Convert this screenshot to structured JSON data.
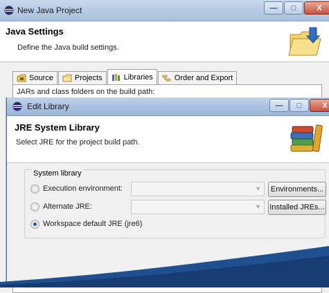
{
  "outer_window": {
    "title": "New Java Project",
    "heading": "Java Settings",
    "description": "Define the Java build settings.",
    "tabs": [
      {
        "label": "Source",
        "icon": "source-folder-icon"
      },
      {
        "label": "Projects",
        "icon": "projects-icon"
      },
      {
        "label": "Libraries",
        "icon": "libraries-icon",
        "active": true
      },
      {
        "label": "Order and Export",
        "icon": "order-export-icon"
      }
    ],
    "panel_label": "JARs and class folders on the build path:"
  },
  "dialog": {
    "title": "Edit Library",
    "heading": "JRE System Library",
    "description": "Select JRE for the project build path.",
    "group_title": "System library",
    "options": [
      {
        "label": "Execution environment:",
        "checked": false,
        "combo": "",
        "button": "Environments..."
      },
      {
        "label": "Alternate JRE:",
        "checked": false,
        "combo": "",
        "button": "Installed JREs..."
      },
      {
        "label": "Workspace default JRE (jre6)",
        "checked": true
      }
    ]
  },
  "colors": {
    "titlebar": "#b7cbe4",
    "close_button": "#c8513c",
    "accent_blue": "#1f4f8f"
  }
}
